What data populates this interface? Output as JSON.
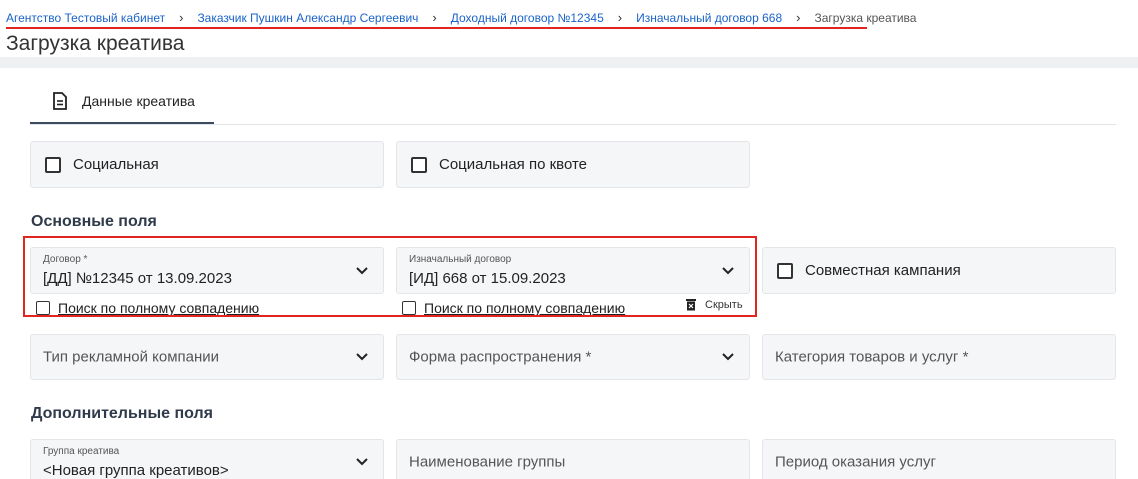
{
  "breadcrumb": {
    "items": [
      "Агентство Тестовый кабинет",
      "Заказчик Пушкин Александр Сергеевич",
      "Доходный договор №12345",
      "Изначальный договор 668"
    ],
    "current": "Загрузка креатива"
  },
  "page_title": "Загрузка креатива",
  "tabs": [
    {
      "label": "Данные креатива",
      "icon": "document-icon"
    }
  ],
  "checkboxes_top": [
    "Социальная",
    "Социальная по квоте"
  ],
  "sections": {
    "main": "Основные поля",
    "extra": "Дополнительные поля"
  },
  "contract": {
    "label": "Договор *",
    "value": "[ДД] №12345 от 13.09.2023",
    "exact_search": "Поиск по полному совпадению"
  },
  "initial_contract": {
    "label": "Изначальный договор",
    "value": "[ИД] 668 от 15.09.2023",
    "exact_search": "Поиск по полному совпадению"
  },
  "hide_label": "Скрыть",
  "joint_campaign": "Совместная кампания",
  "ad_type": {
    "placeholder": "Тип рекламной компании"
  },
  "distribution": {
    "placeholder": "Форма распространения *"
  },
  "category": {
    "placeholder": "Категория товаров и услуг *"
  },
  "creative_group": {
    "label": "Группа креатива",
    "value": "<Новая группа креативов>"
  },
  "group_name": {
    "placeholder": "Наименование группы"
  },
  "service_period": {
    "placeholder": "Период оказания услуг"
  },
  "colors": {
    "link": "#1a63c9",
    "highlight": "#e0261f",
    "field_bg": "#f5f6f7"
  }
}
